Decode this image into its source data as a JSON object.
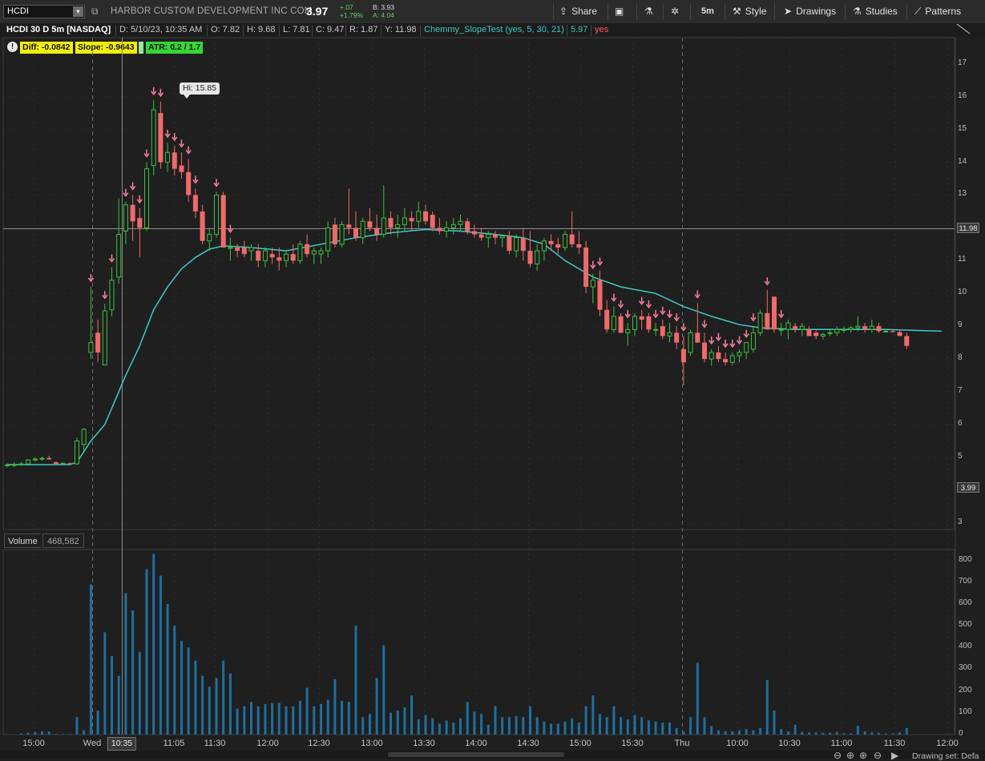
{
  "header": {
    "symbol": "HCDI",
    "company": "HARBOR CUSTOM DEVELOPMENT INC COM",
    "last": "3.97",
    "net_change": "+.07",
    "pct_change": "+1.79%",
    "bid": "B: 3.93",
    "ask": "A: 4.04",
    "buttons": {
      "share": "Share",
      "interval": "5m",
      "style": "Style",
      "drawings": "Drawings",
      "studies": "Studies",
      "patterns": "Patterns"
    }
  },
  "info_bar": {
    "title": "HCDI 30 D 5m [NASDAQ]",
    "date": "D: 5/10/23, 10:35 AM",
    "open": "O: 7.82",
    "high": "H: 9.68",
    "low": "L: 7.81",
    "close": "C: 9.47",
    "range": "R: 1.87",
    "y": "Y: 11.98",
    "study": "Chemmy_SlopeTest (yes, 5, 30, 21)",
    "study_value": "5.97",
    "study_flag": "yes"
  },
  "labels": {
    "diff": "Diff: -0.0842",
    "slope": "Slope: -0.9643",
    "atr": "ATR: 0.2 / 1.7"
  },
  "price_axis": {
    "ticks": [
      "17",
      "16",
      "15",
      "14",
      "13",
      "12",
      "11",
      "10",
      "9",
      "8",
      "7",
      "6",
      "5",
      "4",
      "3"
    ],
    "cursor_value": "11.98",
    "last_value": "3.99"
  },
  "hi_callout": "Hi: 15.85",
  "volume": {
    "title": "Volume",
    "value": "468,582",
    "ticks": [
      "800",
      "700",
      "600",
      "500",
      "400",
      "300",
      "200",
      "100",
      "0"
    ]
  },
  "time_axis": {
    "labels": [
      "15:00",
      "Wed",
      "11:05",
      "11:30",
      "12:00",
      "12:30",
      "13:00",
      "13:30",
      "14:00",
      "14:30",
      "15:00",
      "15:30",
      "Thu",
      "10:00",
      "10:30",
      "11:00",
      "11:30",
      "12:00"
    ],
    "cursor_time": "10:35"
  },
  "footer": {
    "drawing_set": "Drawing set: Defa"
  },
  "colors": {
    "up": "#3cc23c",
    "down": "#f06a6a",
    "arrow": "#ff7f9f",
    "ma_line": "#3ec9c9",
    "volume": "#1e6fa0"
  },
  "chart_data": {
    "type": "candlestick",
    "ylim": [
      2.8,
      17.8
    ],
    "volume_ylim": [
      0,
      850
    ],
    "candles": [
      {
        "o": 4.75,
        "h": 4.82,
        "l": 4.7,
        "c": 4.77,
        "v": 0
      },
      {
        "o": 4.77,
        "h": 4.85,
        "l": 4.7,
        "c": 4.78,
        "v": 0
      },
      {
        "o": 4.78,
        "h": 4.86,
        "l": 4.74,
        "c": 4.8,
        "v": 5
      },
      {
        "o": 4.8,
        "h": 4.95,
        "l": 4.78,
        "c": 4.92,
        "v": 8
      },
      {
        "o": 4.92,
        "h": 5.0,
        "l": 4.86,
        "c": 4.95,
        "v": 12
      },
      {
        "o": 4.95,
        "h": 5.02,
        "l": 4.9,
        "c": 4.97,
        "v": 15
      },
      {
        "o": 4.98,
        "h": 5.05,
        "l": 4.92,
        "c": 4.94,
        "v": 14
      },
      {
        "o": 4.85,
        "h": 4.88,
        "l": 4.78,
        "c": 4.8,
        "v": 4
      },
      {
        "o": 4.8,
        "h": 4.84,
        "l": 4.77,
        "c": 4.82,
        "v": 3
      },
      {
        "o": 4.82,
        "h": 4.85,
        "l": 4.76,
        "c": 4.8,
        "v": 2
      },
      {
        "o": 4.8,
        "h": 5.6,
        "l": 4.78,
        "c": 5.5,
        "v": 80
      },
      {
        "o": 5.4,
        "h": 5.9,
        "l": 5.2,
        "c": 5.85,
        "v": 20
      },
      {
        "o": 8.2,
        "h": 10.2,
        "l": 8.0,
        "c": 8.5,
        "v": 690
      },
      {
        "o": 8.8,
        "h": 9.2,
        "l": 7.9,
        "c": 8.2,
        "v": 110
      },
      {
        "o": 7.82,
        "h": 9.68,
        "l": 7.81,
        "c": 9.47,
        "v": 470
      },
      {
        "o": 9.5,
        "h": 10.8,
        "l": 9.3,
        "c": 10.4,
        "v": 360
      },
      {
        "o": 10.5,
        "h": 12.9,
        "l": 10.3,
        "c": 11.8,
        "v": 270
      },
      {
        "o": 11.9,
        "h": 12.8,
        "l": 11.5,
        "c": 12.7,
        "v": 650
      },
      {
        "o": 12.7,
        "h": 13.0,
        "l": 11.6,
        "c": 12.2,
        "v": 570
      },
      {
        "o": 12.3,
        "h": 12.6,
        "l": 11.1,
        "c": 12.0,
        "v": 380
      },
      {
        "o": 12.0,
        "h": 14.0,
        "l": 11.9,
        "c": 13.8,
        "v": 760
      },
      {
        "o": 13.9,
        "h": 15.9,
        "l": 13.6,
        "c": 15.6,
        "v": 830
      },
      {
        "o": 15.5,
        "h": 15.85,
        "l": 13.8,
        "c": 14.0,
        "v": 730
      },
      {
        "o": 14.0,
        "h": 14.6,
        "l": 13.7,
        "c": 14.3,
        "v": 600
      },
      {
        "o": 14.3,
        "h": 14.5,
        "l": 13.6,
        "c": 13.8,
        "v": 500
      },
      {
        "o": 13.9,
        "h": 14.3,
        "l": 13.5,
        "c": 13.7,
        "v": 430
      },
      {
        "o": 13.7,
        "h": 14.1,
        "l": 12.8,
        "c": 13.0,
        "v": 400
      },
      {
        "o": 13.0,
        "h": 13.2,
        "l": 12.3,
        "c": 12.5,
        "v": 340
      },
      {
        "o": 12.5,
        "h": 12.7,
        "l": 11.5,
        "c": 11.6,
        "v": 270
      },
      {
        "o": 11.6,
        "h": 12.0,
        "l": 11.3,
        "c": 11.8,
        "v": 220
      },
      {
        "o": 11.8,
        "h": 13.1,
        "l": 11.7,
        "c": 13.0,
        "v": 260
      },
      {
        "o": 13.0,
        "h": 13.1,
        "l": 11.4,
        "c": 11.4,
        "v": 340
      },
      {
        "o": 11.4,
        "h": 11.7,
        "l": 11.0,
        "c": 11.4,
        "v": 280
      },
      {
        "o": 11.4,
        "h": 11.5,
        "l": 11.1,
        "c": 11.3,
        "v": 120
      },
      {
        "o": 11.4,
        "h": 11.6,
        "l": 11.1,
        "c": 11.2,
        "v": 130
      },
      {
        "o": 11.3,
        "h": 11.5,
        "l": 11.0,
        "c": 11.4,
        "v": 150
      },
      {
        "o": 11.3,
        "h": 11.5,
        "l": 10.8,
        "c": 11.0,
        "v": 130
      },
      {
        "o": 11.0,
        "h": 11.4,
        "l": 10.8,
        "c": 11.3,
        "v": 140
      },
      {
        "o": 11.2,
        "h": 11.4,
        "l": 10.9,
        "c": 11.1,
        "v": 145
      },
      {
        "o": 11.1,
        "h": 11.4,
        "l": 10.7,
        "c": 11.0,
        "v": 145
      },
      {
        "o": 11.0,
        "h": 11.3,
        "l": 10.8,
        "c": 11.2,
        "v": 130
      },
      {
        "o": 11.2,
        "h": 11.5,
        "l": 10.9,
        "c": 11.0,
        "v": 130
      },
      {
        "o": 11.0,
        "h": 11.6,
        "l": 10.9,
        "c": 11.5,
        "v": 155
      },
      {
        "o": 11.5,
        "h": 11.8,
        "l": 11.1,
        "c": 11.2,
        "v": 215
      },
      {
        "o": 11.2,
        "h": 11.4,
        "l": 10.9,
        "c": 11.3,
        "v": 130
      },
      {
        "o": 11.2,
        "h": 11.4,
        "l": 10.9,
        "c": 11.3,
        "v": 140
      },
      {
        "o": 11.3,
        "h": 12.2,
        "l": 11.1,
        "c": 12.0,
        "v": 160
      },
      {
        "o": 12.1,
        "h": 12.3,
        "l": 11.4,
        "c": 11.5,
        "v": 255
      },
      {
        "o": 11.5,
        "h": 12.2,
        "l": 11.4,
        "c": 12.1,
        "v": 155
      },
      {
        "o": 12.1,
        "h": 13.2,
        "l": 11.8,
        "c": 12.0,
        "v": 150
      },
      {
        "o": 12.0,
        "h": 12.5,
        "l": 11.6,
        "c": 11.7,
        "v": 500
      },
      {
        "o": 11.7,
        "h": 12.3,
        "l": 11.5,
        "c": 12.2,
        "v": 80
      },
      {
        "o": 12.2,
        "h": 12.6,
        "l": 11.9,
        "c": 12.0,
        "v": 95
      },
      {
        "o": 12.0,
        "h": 12.4,
        "l": 11.6,
        "c": 11.8,
        "v": 260
      },
      {
        "o": 11.8,
        "h": 13.3,
        "l": 11.7,
        "c": 12.3,
        "v": 410
      },
      {
        "o": 12.3,
        "h": 12.5,
        "l": 11.8,
        "c": 12.0,
        "v": 100
      },
      {
        "o": 12.0,
        "h": 12.4,
        "l": 11.7,
        "c": 12.1,
        "v": 110
      },
      {
        "o": 12.1,
        "h": 12.6,
        "l": 11.9,
        "c": 12.3,
        "v": 125
      },
      {
        "o": 12.3,
        "h": 12.5,
        "l": 11.9,
        "c": 12.2,
        "v": 180
      },
      {
        "o": 12.2,
        "h": 12.8,
        "l": 12.0,
        "c": 12.5,
        "v": 70
      },
      {
        "o": 12.5,
        "h": 12.7,
        "l": 12.1,
        "c": 12.2,
        "v": 90
      },
      {
        "o": 12.4,
        "h": 12.5,
        "l": 11.9,
        "c": 12.0,
        "v": 75
      },
      {
        "o": 12.0,
        "h": 12.3,
        "l": 11.8,
        "c": 11.9,
        "v": 50
      },
      {
        "o": 11.9,
        "h": 12.2,
        "l": 11.7,
        "c": 12.0,
        "v": 65
      },
      {
        "o": 12.0,
        "h": 12.3,
        "l": 11.8,
        "c": 12.1,
        "v": 55
      },
      {
        "o": 12.1,
        "h": 12.4,
        "l": 11.9,
        "c": 12.2,
        "v": 75
      },
      {
        "o": 12.2,
        "h": 12.3,
        "l": 11.8,
        "c": 11.9,
        "v": 150
      },
      {
        "o": 11.9,
        "h": 12.1,
        "l": 11.7,
        "c": 11.8,
        "v": 105
      },
      {
        "o": 11.8,
        "h": 12.0,
        "l": 11.6,
        "c": 11.7,
        "v": 95
      },
      {
        "o": 11.7,
        "h": 11.9,
        "l": 11.4,
        "c": 11.8,
        "v": 45
      },
      {
        "o": 11.8,
        "h": 11.9,
        "l": 11.5,
        "c": 11.7,
        "v": 130
      },
      {
        "o": 11.7,
        "h": 11.8,
        "l": 11.4,
        "c": 11.75,
        "v": 80
      },
      {
        "o": 11.75,
        "h": 11.9,
        "l": 11.2,
        "c": 11.3,
        "v": 80
      },
      {
        "o": 11.3,
        "h": 11.8,
        "l": 11.1,
        "c": 11.7,
        "v": 85
      },
      {
        "o": 11.7,
        "h": 12.0,
        "l": 11.0,
        "c": 11.3,
        "v": 80
      },
      {
        "o": 11.3,
        "h": 11.9,
        "l": 10.8,
        "c": 10.9,
        "v": 130
      },
      {
        "o": 10.9,
        "h": 11.5,
        "l": 10.7,
        "c": 11.3,
        "v": 80
      },
      {
        "o": 11.3,
        "h": 11.7,
        "l": 11.0,
        "c": 11.6,
        "v": 60
      },
      {
        "o": 11.6,
        "h": 11.8,
        "l": 11.3,
        "c": 11.5,
        "v": 50
      },
      {
        "o": 11.5,
        "h": 11.7,
        "l": 11.2,
        "c": 11.4,
        "v": 50
      },
      {
        "o": 11.4,
        "h": 11.9,
        "l": 11.3,
        "c": 11.8,
        "v": 60
      },
      {
        "o": 11.8,
        "h": 12.5,
        "l": 11.4,
        "c": 11.5,
        "v": 75
      },
      {
        "o": 11.5,
        "h": 11.9,
        "l": 11.2,
        "c": 11.4,
        "v": 55
      },
      {
        "o": 11.4,
        "h": 11.6,
        "l": 10.0,
        "c": 10.2,
        "v": 130
      },
      {
        "o": 10.2,
        "h": 10.6,
        "l": 9.7,
        "c": 10.4,
        "v": 180
      },
      {
        "o": 10.4,
        "h": 10.7,
        "l": 9.3,
        "c": 9.5,
        "v": 95
      },
      {
        "o": 9.5,
        "h": 9.8,
        "l": 8.8,
        "c": 8.9,
        "v": 80
      },
      {
        "o": 8.9,
        "h": 9.6,
        "l": 8.8,
        "c": 9.3,
        "v": 130
      },
      {
        "o": 9.3,
        "h": 9.4,
        "l": 8.8,
        "c": 8.8,
        "v": 80
      },
      {
        "o": 8.8,
        "h": 9.1,
        "l": 8.4,
        "c": 8.9,
        "v": 70
      },
      {
        "o": 8.9,
        "h": 9.4,
        "l": 8.7,
        "c": 9.3,
        "v": 90
      },
      {
        "o": 9.3,
        "h": 9.5,
        "l": 8.9,
        "c": 9.2,
        "v": 80
      },
      {
        "o": 9.3,
        "h": 9.4,
        "l": 8.8,
        "c": 8.9,
        "v": 65
      },
      {
        "o": 8.9,
        "h": 9.1,
        "l": 8.7,
        "c": 8.9,
        "v": 60
      },
      {
        "o": 9.0,
        "h": 9.2,
        "l": 8.6,
        "c": 8.7,
        "v": 55
      },
      {
        "o": 8.7,
        "h": 9.1,
        "l": 8.5,
        "c": 8.8,
        "v": 55
      },
      {
        "o": 8.8,
        "h": 9.0,
        "l": 8.3,
        "c": 8.5,
        "v": 30
      },
      {
        "o": 8.3,
        "h": 8.7,
        "l": 7.2,
        "c": 7.9,
        "v": 15
      },
      {
        "o": 8.2,
        "h": 8.9,
        "l": 8.1,
        "c": 8.8,
        "v": 80
      },
      {
        "o": 8.8,
        "h": 9.7,
        "l": 8.7,
        "c": 8.5,
        "v": 330
      },
      {
        "o": 8.5,
        "h": 8.8,
        "l": 7.9,
        "c": 8.0,
        "v": 80
      },
      {
        "o": 8.0,
        "h": 8.3,
        "l": 7.8,
        "c": 8.2,
        "v": 40
      },
      {
        "o": 8.2,
        "h": 8.4,
        "l": 7.9,
        "c": 8.0,
        "v": 20
      },
      {
        "o": 8.0,
        "h": 8.2,
        "l": 7.8,
        "c": 7.9,
        "v": 15
      },
      {
        "o": 7.9,
        "h": 8.2,
        "l": 7.8,
        "c": 8.1,
        "v": 15
      },
      {
        "o": 8.1,
        "h": 8.3,
        "l": 7.9,
        "c": 8.2,
        "v": 20
      },
      {
        "o": 8.2,
        "h": 8.5,
        "l": 8.0,
        "c": 8.5,
        "v": 25
      },
      {
        "o": 8.3,
        "h": 9.0,
        "l": 8.2,
        "c": 8.8,
        "v": 20
      },
      {
        "o": 8.8,
        "h": 9.5,
        "l": 8.7,
        "c": 9.4,
        "v": 30
      },
      {
        "o": 9.4,
        "h": 10.1,
        "l": 8.9,
        "c": 8.9,
        "v": 250
      },
      {
        "o": 9.9,
        "h": 9.9,
        "l": 8.8,
        "c": 8.9,
        "v": 110
      },
      {
        "o": 8.9,
        "h": 9.1,
        "l": 8.7,
        "c": 8.9,
        "v": 25
      },
      {
        "o": 8.9,
        "h": 9.2,
        "l": 8.6,
        "c": 9.1,
        "v": 15
      },
      {
        "o": 9.0,
        "h": 9.1,
        "l": 8.8,
        "c": 8.9,
        "v": 45
      },
      {
        "o": 8.9,
        "h": 9.1,
        "l": 8.7,
        "c": 9.0,
        "v": 12
      },
      {
        "o": 8.9,
        "h": 9.0,
        "l": 8.7,
        "c": 8.7,
        "v": 10
      },
      {
        "o": 8.8,
        "h": 8.9,
        "l": 8.6,
        "c": 8.7,
        "v": 10
      },
      {
        "o": 8.7,
        "h": 8.8,
        "l": 8.6,
        "c": 8.75,
        "v": 8
      },
      {
        "o": 8.8,
        "h": 8.9,
        "l": 8.7,
        "c": 8.8,
        "v": 8
      },
      {
        "o": 8.8,
        "h": 9.0,
        "l": 8.7,
        "c": 8.9,
        "v": 12
      },
      {
        "o": 8.9,
        "h": 9.0,
        "l": 8.8,
        "c": 8.9,
        "v": 6
      },
      {
        "o": 8.9,
        "h": 9.0,
        "l": 8.8,
        "c": 8.95,
        "v": 5
      },
      {
        "o": 8.95,
        "h": 9.3,
        "l": 8.85,
        "c": 9.0,
        "v": 40
      },
      {
        "o": 9.0,
        "h": 9.1,
        "l": 8.8,
        "c": 8.9,
        "v": 15
      },
      {
        "o": 8.9,
        "h": 9.2,
        "l": 8.8,
        "c": 9.0,
        "v": 10
      },
      {
        "o": 9.0,
        "h": 9.1,
        "l": 8.8,
        "c": 8.85,
        "v": 8
      },
      {
        "o": 8.85,
        "h": 8.9,
        "l": 8.8,
        "c": 8.85,
        "v": 5
      },
      {
        "o": 8.85,
        "h": 8.9,
        "l": 8.8,
        "c": 8.82,
        "v": 5
      },
      {
        "o": 8.82,
        "h": 8.9,
        "l": 8.7,
        "c": 8.7,
        "v": 10
      },
      {
        "o": 8.7,
        "h": 8.8,
        "l": 8.3,
        "c": 8.4,
        "v": 30
      }
    ],
    "arrows_at_candles": [
      12,
      14,
      15,
      17,
      18,
      19,
      20,
      21,
      22,
      23,
      24,
      25,
      26,
      27,
      30,
      32,
      84,
      85,
      87,
      88,
      89,
      91,
      92,
      93,
      94,
      95,
      96,
      97,
      99,
      100,
      101,
      102,
      103,
      104,
      105,
      106,
      107,
      109,
      111
    ],
    "moving_average": [
      [
        0,
        4.78
      ],
      [
        9,
        4.78
      ],
      [
        10,
        4.85
      ],
      [
        12,
        5.5
      ],
      [
        14,
        6.0
      ],
      [
        15,
        6.5
      ],
      [
        17,
        7.5
      ],
      [
        19,
        8.4
      ],
      [
        21,
        9.5
      ],
      [
        23,
        10.2
      ],
      [
        25,
        10.75
      ],
      [
        27,
        11.1
      ],
      [
        29,
        11.35
      ],
      [
        31,
        11.45
      ],
      [
        35,
        11.4
      ],
      [
        40,
        11.3
      ],
      [
        45,
        11.5
      ],
      [
        50,
        11.7
      ],
      [
        55,
        11.85
      ],
      [
        60,
        11.95
      ],
      [
        65,
        11.9
      ],
      [
        70,
        11.8
      ],
      [
        74,
        11.7
      ],
      [
        77,
        11.5
      ],
      [
        80,
        11.0
      ],
      [
        84,
        10.5
      ],
      [
        88,
        10.2
      ],
      [
        93,
        10.0
      ],
      [
        97,
        9.6
      ],
      [
        101,
        9.3
      ],
      [
        105,
        9.05
      ],
      [
        108,
        8.95
      ],
      [
        113,
        8.9
      ],
      [
        120,
        8.9
      ],
      [
        126,
        8.9
      ],
      [
        134,
        8.85
      ]
    ]
  }
}
